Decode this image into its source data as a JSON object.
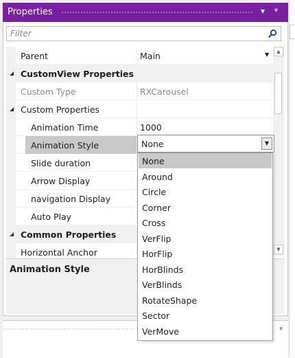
{
  "panel": {
    "title": "Properties",
    "dropdown_glyph": "▾",
    "pin_glyph": "ᵠ"
  },
  "filter": {
    "placeholder": "Filter"
  },
  "grid": {
    "parent_label": "Parent",
    "parent_value": "Main",
    "customview_header": "CustomView Properties",
    "custom_type_label": "Custom Type",
    "custom_type_value": "RXCarousel",
    "custom_props_header": "Custom Properties",
    "animation_time_label": "Animation Time",
    "animation_time_value": "1000",
    "animation_style_label": "Animation Style",
    "animation_style_value": "None",
    "slide_duration_label": "Slide duration",
    "arrow_display_label": "Arrow Display",
    "navigation_display_label": "navigation Display",
    "auto_play_label": "Auto Play",
    "common_header": "Common Properties",
    "horizontal_anchor_label": "Horizontal Anchor"
  },
  "description": {
    "title": "Animation Style"
  },
  "dropdown": {
    "selected": "None",
    "options": [
      "None",
      "Around",
      "Circle",
      "Corner",
      "Cross",
      "VerFlip",
      "HorFlip",
      "HorBlinds",
      "VerBlinds",
      "RotateShape",
      "Sector",
      "VerMove"
    ]
  },
  "icons": {
    "search": "search-icon",
    "expand": "expanded-triangle-icon",
    "combo_arrow": "chevron-down-icon"
  },
  "colors": {
    "accent": "#7b1fa2",
    "selection": "#c9c9c9"
  }
}
